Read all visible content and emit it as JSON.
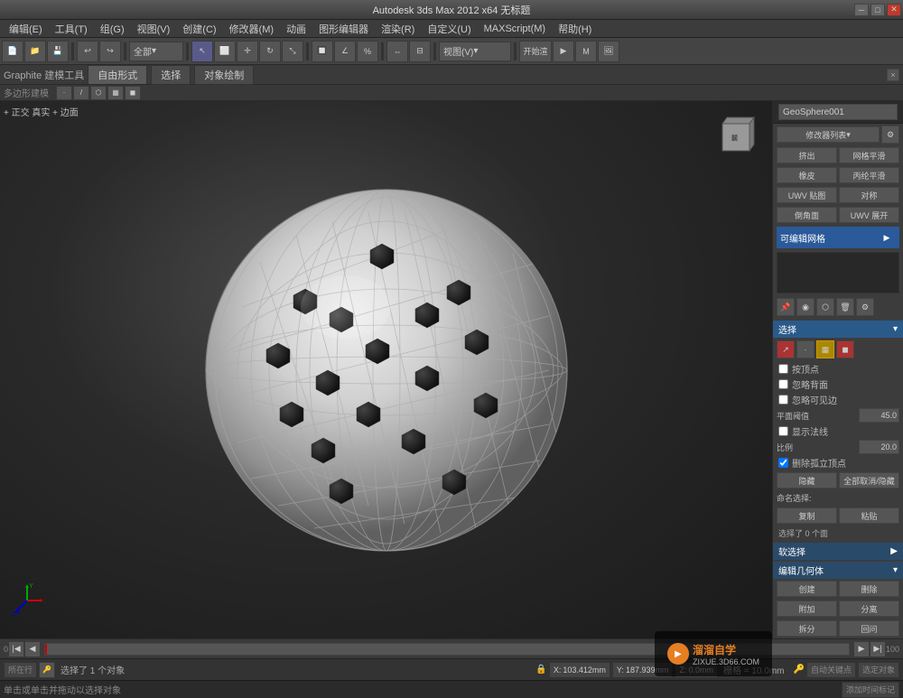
{
  "titlebar": {
    "title": "Autodesk 3ds Max  2012 x64  无标题",
    "controls": [
      "minimize",
      "maximize",
      "close"
    ]
  },
  "menubar": {
    "items": [
      "编辑(E)",
      "工具(T)",
      "组(G)",
      "视图(V)",
      "创建(C)",
      "修改器(M)",
      "动画",
      "图形编辑器",
      "渲染(R)",
      "自定义(U)",
      "MAXScript(M)",
      "帮助(H)"
    ]
  },
  "toolbar": {
    "dropdown_label": "全部",
    "view_label": "视图(V)"
  },
  "graphite_bar": {
    "label": "Graphite 建模工具",
    "tabs": [
      "自由形式",
      "选择",
      "对象绘制"
    ],
    "close_label": "×"
  },
  "sub_toolbar": {
    "label": "多边形建模"
  },
  "viewport": {
    "label": "+ 正交  真实 + 边面",
    "bg_color": "#2a2a2a"
  },
  "right_panel": {
    "object_name": "GeoSphere001",
    "modifier_label": "修改器列表",
    "buttons": {
      "push": "挤出",
      "mesh_smooth": "网格平滑",
      "rubber": "橡皮",
      "poly_smooth": "丙纶平滑",
      "uvw_map": "UWV 贴图",
      "symmetry": "对称",
      "bevel": "倒角面",
      "uvw_unwrap": "UWV 展开"
    },
    "editable_poly_label": "可编辑网格",
    "select_section": {
      "title": "选择",
      "by_vertex": "按顶点",
      "ignore_backface": "忽略背面",
      "ignore_visible_edges": "忽略可见边",
      "planar_threshold_label": "平面阈值",
      "planar_threshold_value": "45.0",
      "show_normals": "显示法线",
      "scale_label": "比例",
      "scale_value": "20.0",
      "delete_isolated": "删除孤立顶点",
      "hide_label": "隐藏",
      "unhide_all": "全部取消/隐藏",
      "named_select": "命名选择:",
      "copy": "复制",
      "paste": "粘贴",
      "selected_count": "选择了 0 个面"
    },
    "soft_select": {
      "title": "软选择"
    },
    "edit_geometry": {
      "title": "编辑几何体",
      "create": "创建",
      "delete_btn": "删除",
      "attach": "附加",
      "detach": "分离",
      "divide": "拆分",
      "undo": "回问"
    }
  },
  "timeline": {
    "start": "0",
    "end": "100",
    "current": "0"
  },
  "statusbar": {
    "activity_label": "所在行",
    "selected_text": "选择了 1 个对象",
    "x_label": "X:",
    "x_value": "103.412mm",
    "y_label": "Y:",
    "y_value": "187.939mm",
    "z_label": "Z:",
    "z_value": "0.0mm",
    "grid_label": "栅格 = 10.0mm",
    "auto_key": "自动关键点",
    "set_key": "选定对象",
    "add_time_tag": "添加时间标记"
  },
  "infobar": {
    "click_info": "单击或单击并拖动以选择对象"
  },
  "watermark": {
    "line1": "溜溜自学",
    "line2": "ZIXUE.3D66.COM"
  }
}
